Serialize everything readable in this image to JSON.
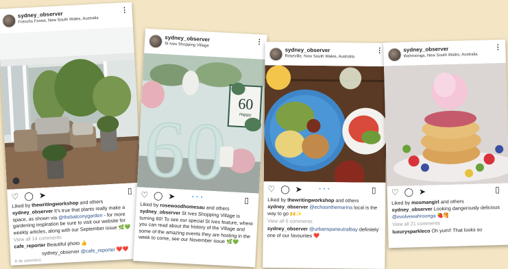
{
  "posts": [
    {
      "username": "sydney_observer",
      "location": "Frenchs Forest, New South Wales, Australia",
      "likes_prefix": "Liked by",
      "liked_by": "thewritingworkshop",
      "likes_suffix": "and others",
      "caption_user": "sydney_observer",
      "caption_parts": [
        "It's true that plants really make a space, as shown via",
        "@thebalconygarden",
        "- for more gardening inspiration be sure to visit our website for weekly articles, along with our September issue 🌿💚"
      ],
      "view_comments": "View all 14 comments",
      "comments": [
        {
          "user": "cafe_reporter",
          "text": "Beautiful photo 👍"
        },
        {
          "user": "sydney_observer",
          "mention": "@cafe_reporter",
          "text": "❤️❤️"
        }
      ],
      "timestamp": "8 de setembro"
    },
    {
      "username": "sydney_observer",
      "location": "St Ives Shopping Village",
      "likes_prefix": "Liked by",
      "liked_by": "rosewoodhomesau",
      "likes_suffix": "and others",
      "caption_user": "sydney_observer",
      "caption": "St Ives Shopping Village is turning 60! To see our special St Ives feature, where you can read about the history of the Village and some of the amazing events they are hosting in the week to come, see our November issue 🌿💚",
      "sign_number": "60",
      "sign_text": "Happy"
    },
    {
      "username": "sydney_observer",
      "location": "Roseville, New South Wales, Australia",
      "likes_prefix": "Liked by",
      "liked_by": "thewritingworkshop",
      "likes_suffix": "and others",
      "caption_user": "sydney_observer",
      "caption_mention": "@echoonthemarina",
      "caption_rest": "local is the way to go 🙌✨",
      "view_comments": "View all 6 comments",
      "comment_user": "sydney_observer",
      "comment_mention": "@urbanspaneutralbay",
      "comment_text": "definitely one of our favourites ❤️"
    },
    {
      "username": "sydney_observer",
      "location": "Wahroonga, New South Wales, Australia",
      "likes_prefix": "Liked by",
      "liked_by": "mosmangirl",
      "likes_suffix": "and others",
      "caption_user": "sydney_observer",
      "caption_rest": "Looking dangerously delicious",
      "caption_mention": "@evolvewahroonga",
      "caption_emoji": "🍓🥞",
      "view_comments": "View all 21 comments",
      "comment_user": "luxurysparkleco",
      "comment_text": "Oh yum!! That looks so"
    }
  ],
  "icons": {
    "heart": "♡",
    "comment": "◯",
    "share": "➤",
    "save": "▯",
    "more": "⋮",
    "carousel_dots": "• • •",
    "small_heart": "♡"
  },
  "colors": {
    "background": "#f4e6c4",
    "link": "#2a4f8a",
    "carousel_dot": "#3897f0"
  }
}
